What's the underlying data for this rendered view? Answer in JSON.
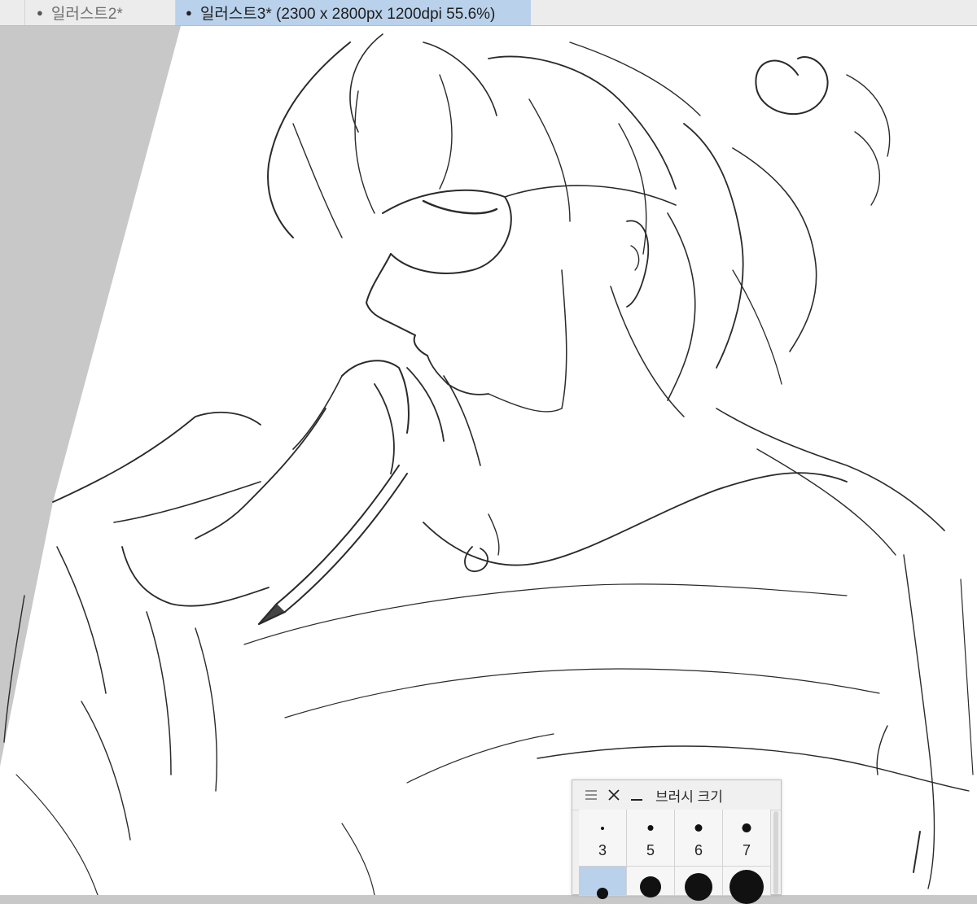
{
  "tabs": [
    {
      "label": "일러스트2*",
      "active": false
    },
    {
      "label": "일러스트3* (2300 x 2800px 1200dpi 55.6%)",
      "active": true
    }
  ],
  "canvas": {
    "description_icon": "pencil-sketch-drawing"
  },
  "brush_palette": {
    "title": "브러시 크기",
    "menu_icon": "hamburger-icon",
    "close_icon": "close-icon",
    "minimize_icon": "minimize-icon",
    "sizes": [
      {
        "label": "3",
        "selected": false
      },
      {
        "label": "5",
        "selected": false
      },
      {
        "label": "6",
        "selected": false
      },
      {
        "label": "7",
        "selected": false
      }
    ],
    "selected_row_index": 0
  },
  "colors": {
    "active_tab": "#b9d1ea",
    "selected_cell": "#b9d1ea",
    "workspace": "#c8c8c8"
  }
}
